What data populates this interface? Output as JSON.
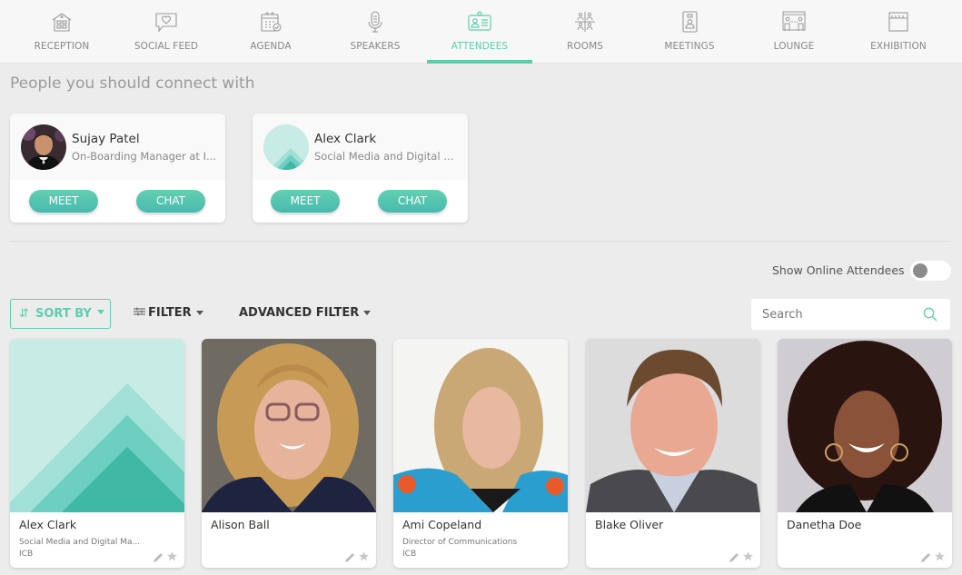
{
  "nav": {
    "items": [
      {
        "label": "RECEPTION",
        "icon": "building-icon",
        "active": false
      },
      {
        "label": "SOCIAL FEED",
        "icon": "chat-heart-icon",
        "active": false
      },
      {
        "label": "AGENDA",
        "icon": "calendar-check-icon",
        "active": false
      },
      {
        "label": "SPEAKERS",
        "icon": "microphone-icon",
        "active": false
      },
      {
        "label": "ATTENDEES",
        "icon": "id-badge-icon",
        "active": true
      },
      {
        "label": "ROOMS",
        "icon": "rooms-grid-icon",
        "active": false
      },
      {
        "label": "MEETINGS",
        "icon": "video-person-icon",
        "active": false
      },
      {
        "label": "LOUNGE",
        "icon": "lounge-table-icon",
        "active": false
      },
      {
        "label": "EXHIBITION",
        "icon": "booth-icon",
        "active": false
      }
    ]
  },
  "colors": {
    "accent": "#5fcdad",
    "accent_dark": "#48b9b0",
    "background": "#ececec"
  },
  "suggestions": {
    "title": "People you should connect with",
    "people": [
      {
        "name": "Sujay Patel",
        "title": "On-Boarding Manager at I...",
        "meet_label": "MEET",
        "chat_label": "CHAT",
        "avatar": "photo"
      },
      {
        "name": "Alex Clark",
        "title": "Social Media and Digital M...",
        "meet_label": "MEET",
        "chat_label": "CHAT",
        "avatar": "placeholder"
      }
    ]
  },
  "toolbar": {
    "online_label": "Show Online Attendees",
    "online_toggle": false,
    "sort_label": "SORT BY",
    "filter_label": "FILTER",
    "advanced_filter_label": "ADVANCED FILTER",
    "search_placeholder": "Search",
    "search_value": ""
  },
  "attendees": [
    {
      "name": "Alex Clark",
      "role": "Social Media and Digital Ma...",
      "org": "ICB",
      "photo": "placeholder"
    },
    {
      "name": "Alison Ball",
      "role": "",
      "org": "",
      "photo": "photo"
    },
    {
      "name": "Ami Copeland",
      "role": "Director of Communications",
      "org": "ICB",
      "photo": "photo"
    },
    {
      "name": "Blake Oliver",
      "role": "",
      "org": "",
      "photo": "photo"
    },
    {
      "name": "Danetha Doe",
      "role": "",
      "org": "",
      "photo": "photo"
    }
  ]
}
